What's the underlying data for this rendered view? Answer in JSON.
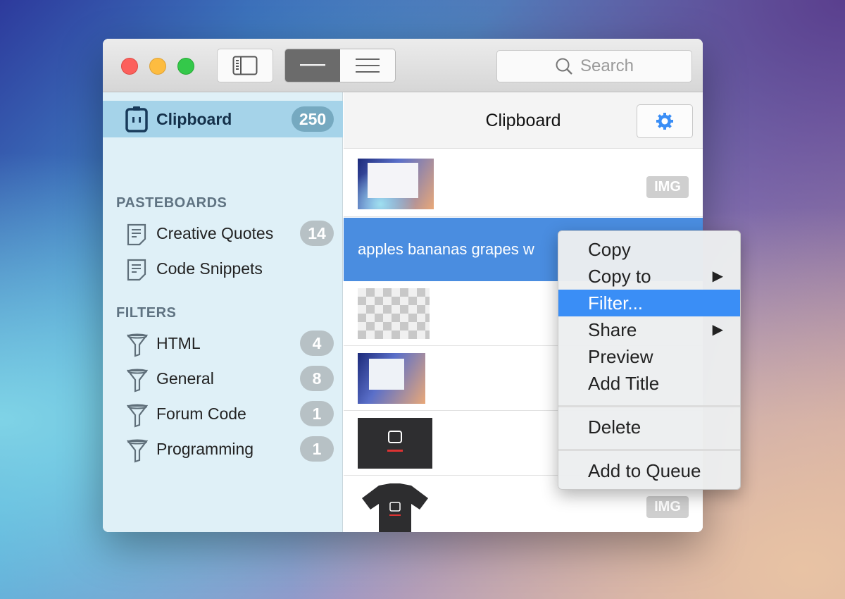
{
  "toolbar": {
    "search_placeholder": "Search"
  },
  "sidebar": {
    "clipboard": {
      "label": "Clipboard",
      "count": "250"
    },
    "pasteboards_header": "PASTEBOARDS",
    "pasteboards": [
      {
        "label": "Creative Quotes",
        "count": "14"
      },
      {
        "label": "Code Snippets",
        "count": ""
      }
    ],
    "filters_header": "FILTERS",
    "filters": [
      {
        "label": "HTML",
        "count": "4"
      },
      {
        "label": "General",
        "count": "8"
      },
      {
        "label": "Forum Code",
        "count": "1"
      },
      {
        "label": "Programming",
        "count": "1"
      }
    ],
    "add_label": "+"
  },
  "main": {
    "title": "Clipboard",
    "items": [
      {
        "type": "image",
        "badge": "IMG"
      },
      {
        "type": "text",
        "text": "apples bananas grapes w"
      },
      {
        "type": "image"
      },
      {
        "type": "image"
      },
      {
        "type": "image"
      },
      {
        "type": "image",
        "badge": "IMG"
      }
    ]
  },
  "context_menu": {
    "items": [
      "Copy",
      "Copy to",
      "Filter...",
      "Share",
      "Preview",
      "Add Title",
      "Delete",
      "Add to Queue"
    ],
    "arrow": "▶"
  },
  "colors": {
    "accent": "#3a8ef6",
    "selection": "#4a8de0",
    "sidebar_selected": "#a5d3e9"
  }
}
